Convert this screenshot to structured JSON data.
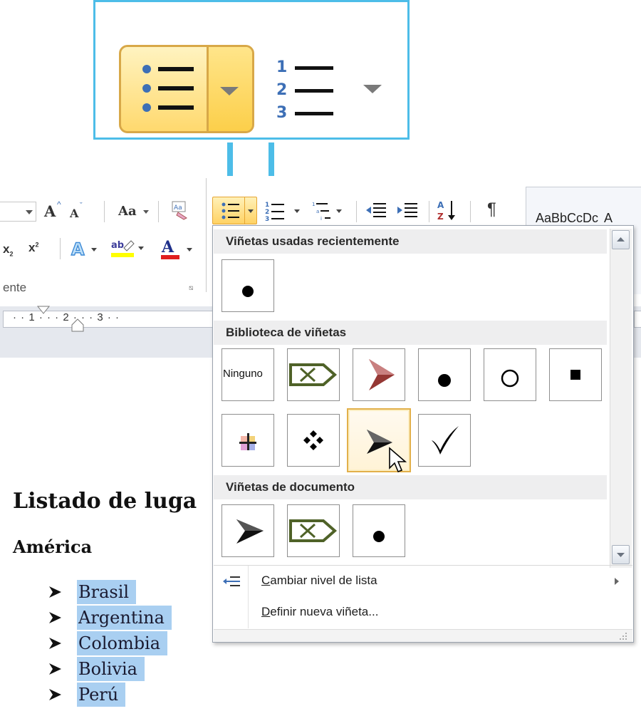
{
  "ribbon": {
    "font_grow": "A",
    "font_shrink": "A",
    "change_case": "Aa",
    "group_label": "ente",
    "styles_preview": "AaBbCcDc",
    "styles_preview_cut": "A",
    "subscript": "x",
    "superscript": "x",
    "pilcrow": "¶"
  },
  "ruler": {
    "marks": "· · 1 · · · 2 · · · 3 · ·"
  },
  "dropdown": {
    "sections": [
      {
        "title": "Viñetas usadas recientemente"
      },
      {
        "title": "Biblioteca de viñetas"
      },
      {
        "title": "Viñetas de documento"
      }
    ],
    "none_label": "Ninguno",
    "menu": {
      "change_level_accel": "C",
      "change_level_rest": "ambiar nivel de lista",
      "define_bullet_accel": "D",
      "define_bullet_rest": "efinir nueva viñeta..."
    }
  },
  "document": {
    "title": "Listado de luga",
    "subtitle": "América",
    "list": [
      "Brasil",
      "Argentina",
      "Colombia",
      "Bolivia",
      "Perú"
    ]
  },
  "colors": {
    "accent_blue": "#4dbde8",
    "highlight": "#a9cff1",
    "hover_border": "#e2b04a",
    "bullet_green": "#4f6228",
    "bullet_red": "#953734"
  },
  "icons": {
    "bullets_button": "bullet-list-icon",
    "numbering_button": "numbered-list-icon",
    "multilevel_button": "multilevel-list-icon",
    "sort": "sort-az-icon",
    "show_marks": "pilcrow-icon"
  }
}
